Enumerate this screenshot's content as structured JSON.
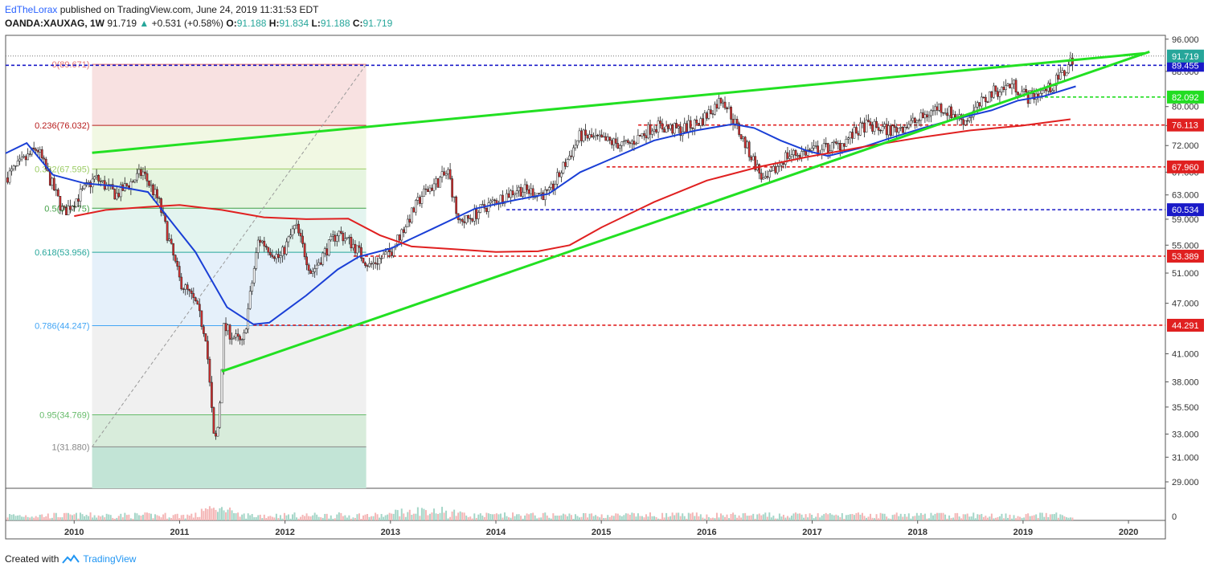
{
  "header": {
    "author": "EdTheLorax",
    "published": "published on TradingView.com, June 24, 2019 11:31:53 EDT",
    "symbol": "OANDA:XAUXAG, 1W",
    "last": "91.719",
    "change": "+0.531 (+0.58%)",
    "o_label": "O:",
    "o": "91.188",
    "h_label": "H:",
    "h": "91.834",
    "l_label": "L:",
    "l": "91.188",
    "c_label": "C:",
    "c": "91.719"
  },
  "footer": {
    "created": "Created with",
    "brand": "TradingView"
  },
  "chart_data": {
    "type": "candlestick",
    "y_scale": "log",
    "ylim": [
      28.5,
      97
    ],
    "y_ticks": [
      "96.000",
      "88.000",
      "80.000",
      "76.000",
      "72.000",
      "67.000",
      "63.000",
      "59.000",
      "55.000",
      "51.000",
      "47.000",
      "41.000",
      "38.000",
      "35.500",
      "33.000",
      "31.000",
      "29.000"
    ],
    "x_ticks": [
      "2010",
      "2011",
      "2012",
      "2013",
      "2014",
      "2015",
      "2016",
      "2017",
      "2018",
      "2019",
      "2020"
    ],
    "price_path": [
      [
        2009.35,
        66
      ],
      [
        2009.65,
        71.5
      ],
      [
        2009.9,
        60
      ],
      [
        2010.2,
        66
      ],
      [
        2010.4,
        63
      ],
      [
        2010.65,
        67
      ],
      [
        2010.8,
        62
      ],
      [
        2011.0,
        50
      ],
      [
        2011.15,
        47
      ],
      [
        2011.25,
        43
      ],
      [
        2011.33,
        32
      ],
      [
        2011.37,
        34
      ],
      [
        2011.42,
        44
      ],
      [
        2011.6,
        42
      ],
      [
        2011.75,
        56
      ],
      [
        2011.95,
        53
      ],
      [
        2012.1,
        58
      ],
      [
        2012.25,
        51
      ],
      [
        2012.5,
        57
      ],
      [
        2012.65,
        55
      ],
      [
        2012.8,
        52
      ],
      [
        2013.0,
        54
      ],
      [
        2013.3,
        63
      ],
      [
        2013.55,
        67
      ],
      [
        2013.65,
        58
      ],
      [
        2013.9,
        61
      ],
      [
        2014.2,
        64
      ],
      [
        2014.5,
        63
      ],
      [
        2014.8,
        74
      ],
      [
        2015.0,
        73
      ],
      [
        2015.25,
        72
      ],
      [
        2015.5,
        76
      ],
      [
        2015.75,
        75
      ],
      [
        2015.95,
        77
      ],
      [
        2016.15,
        82
      ],
      [
        2016.3,
        75
      ],
      [
        2016.55,
        65
      ],
      [
        2016.75,
        70
      ],
      [
        2017.0,
        71
      ],
      [
        2017.25,
        72
      ],
      [
        2017.5,
        76
      ],
      [
        2017.75,
        75
      ],
      [
        2018.0,
        77
      ],
      [
        2018.2,
        80
      ],
      [
        2018.45,
        77
      ],
      [
        2018.7,
        83
      ],
      [
        2018.9,
        85
      ],
      [
        2019.05,
        82
      ],
      [
        2019.25,
        84
      ],
      [
        2019.4,
        88
      ],
      [
        2019.48,
        91.7
      ]
    ],
    "series": [
      {
        "name": "",
        "type": "line",
        "color": "#1a3fd6",
        "points": [
          [
            2009.35,
            70.5
          ],
          [
            2009.55,
            72.5
          ],
          [
            2009.8,
            66.5
          ],
          [
            2010.1,
            65
          ],
          [
            2010.4,
            64.5
          ],
          [
            2010.7,
            63.5
          ],
          [
            2010.95,
            58
          ],
          [
            2011.15,
            54
          ],
          [
            2011.45,
            46.5
          ],
          [
            2011.7,
            44.4
          ],
          [
            2011.85,
            44.6
          ],
          [
            2012.2,
            48
          ],
          [
            2012.5,
            51.5
          ],
          [
            2012.7,
            53.3
          ],
          [
            2013.0,
            54.5
          ],
          [
            2013.4,
            57.5
          ],
          [
            2013.8,
            60.7
          ],
          [
            2014.2,
            62.2
          ],
          [
            2014.5,
            63.2
          ],
          [
            2014.8,
            67
          ],
          [
            2015.1,
            69.5
          ],
          [
            2015.5,
            73
          ],
          [
            2015.9,
            75
          ],
          [
            2016.25,
            76.3
          ],
          [
            2016.45,
            75.5
          ],
          [
            2016.7,
            73
          ],
          [
            2016.95,
            71
          ],
          [
            2017.15,
            70
          ],
          [
            2017.45,
            71.5
          ],
          [
            2017.75,
            73.5
          ],
          [
            2018.05,
            75.5
          ],
          [
            2018.35,
            77.3
          ],
          [
            2018.7,
            79.2
          ],
          [
            2018.95,
            81.3
          ],
          [
            2019.2,
            82.3
          ],
          [
            2019.5,
            84.5
          ]
        ]
      },
      {
        "name": "",
        "type": "line",
        "color": "#e02020",
        "points": [
          [
            2010.0,
            59.5
          ],
          [
            2010.3,
            60.5
          ],
          [
            2010.7,
            61
          ],
          [
            2011.0,
            61.3
          ],
          [
            2011.4,
            60.5
          ],
          [
            2011.8,
            59.3
          ],
          [
            2012.2,
            59
          ],
          [
            2012.6,
            59.1
          ],
          [
            2012.9,
            56.5
          ],
          [
            2013.2,
            54.8
          ],
          [
            2013.6,
            54.4
          ],
          [
            2014.0,
            54
          ],
          [
            2014.4,
            54.1
          ],
          [
            2014.7,
            55
          ],
          [
            2015.0,
            57.7
          ],
          [
            2015.5,
            61.8
          ],
          [
            2016.0,
            65.5
          ],
          [
            2016.5,
            68
          ],
          [
            2016.95,
            69.8
          ],
          [
            2017.5,
            71.8
          ],
          [
            2018.0,
            73.5
          ],
          [
            2018.5,
            75
          ],
          [
            2019.0,
            76
          ],
          [
            2019.45,
            77.3
          ]
        ]
      },
      {
        "name": "",
        "type": "line",
        "color": "#22e022",
        "points": [
          [
            2010.17,
            70.6
          ],
          [
            2020.15,
            92.4
          ]
        ]
      },
      {
        "name": "",
        "type": "line",
        "color": "#22e022",
        "points": [
          [
            2011.4,
            39.1
          ],
          [
            2020.2,
            92.8
          ]
        ]
      }
    ],
    "fibonacci": {
      "from": [
        2010.17,
        31.88
      ],
      "to": [
        2012.77,
        89.671
      ],
      "levels": [
        {
          "label": "0(89.671)",
          "price": 89.671,
          "color": "#e57373"
        },
        {
          "label": "0.236(76.032)",
          "price": 76.032,
          "color": "#b71c1c"
        },
        {
          "label": "0.382(67.595)",
          "price": 67.595,
          "color": "#9ccc65"
        },
        {
          "label": "0.5(60.775)",
          "price": 60.775,
          "color": "#43a047"
        },
        {
          "label": "0.618(53.956)",
          "price": 53.956,
          "color": "#26a69a"
        },
        {
          "label": "0.786(44.247)",
          "price": 44.247,
          "color": "#42a5f5"
        },
        {
          "label": "0.95(34.769)",
          "price": 34.769,
          "color": "#66bb6a"
        },
        {
          "label": "1(31.880)",
          "price": 31.88,
          "color": "#888888"
        }
      ]
    },
    "horizontal_levels": [
      {
        "price": 89.455,
        "label": "89.455",
        "color": "#1a1ac8",
        "from": 2009.35
      },
      {
        "price": 82.092,
        "label": "82.092",
        "color": "#22dd22",
        "from": 2019.1
      },
      {
        "price": 76.113,
        "label": "76.113",
        "color": "#e02020",
        "from": 2015.35
      },
      {
        "price": 67.96,
        "label": "67.960",
        "color": "#e02020",
        "from": 2015.05
      },
      {
        "price": 60.534,
        "label": "60.534",
        "color": "#1a1ac8",
        "from": 2014.1
      },
      {
        "price": 53.389,
        "label": "53.389",
        "color": "#e02020",
        "from": 2012.65
      },
      {
        "price": 44.291,
        "label": "44.291",
        "color": "#e02020",
        "from": 2011.7
      }
    ],
    "last_price": {
      "price": 91.719,
      "label": "91.719"
    },
    "grid": true,
    "legend": "none"
  }
}
